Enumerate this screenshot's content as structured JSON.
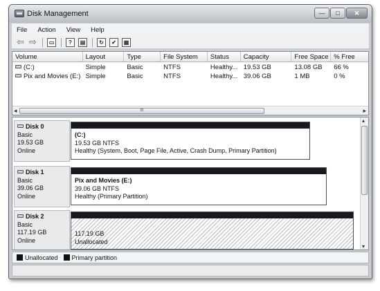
{
  "window": {
    "title": "Disk Management",
    "controls": {
      "minimize": "—",
      "maximize": "□",
      "close": "✕"
    }
  },
  "menu": [
    {
      "label": "File"
    },
    {
      "label": "Action"
    },
    {
      "label": "View"
    },
    {
      "label": "Help"
    }
  ],
  "toolbar": {
    "items": [
      "back-icon",
      "forward-icon",
      "view-toggle-icon",
      "help-icon",
      "detail-pane-icon",
      "refresh-icon",
      "properties-icon",
      "disk-settings-icon"
    ]
  },
  "volume_list": {
    "columns": [
      "Volume",
      "Layout",
      "Type",
      "File System",
      "Status",
      "Capacity",
      "Free Space",
      "% Free"
    ],
    "rows": [
      {
        "volume": "(C:)",
        "layout": "Simple",
        "type": "Basic",
        "fs": "NTFS",
        "status": "Healthy...",
        "capacity": "19.53 GB",
        "free": "13.08 GB",
        "pct": "66 %"
      },
      {
        "volume": "Pix and Movies (E:)",
        "layout": "Simple",
        "type": "Basic",
        "fs": "NTFS",
        "status": "Healthy...",
        "capacity": "39.06 GB",
        "free": "1 MB",
        "pct": "0 %"
      }
    ],
    "scroll_grip": "III"
  },
  "disks": [
    {
      "name": "Disk 0",
      "type": "Basic",
      "size": "19.53 GB",
      "state": "Online",
      "partition": {
        "title": "(C:)",
        "size_fs": "19.53 GB NTFS",
        "status": "Healthy (System, Boot, Page File, Active, Crash Dump, Primary Partition)"
      }
    },
    {
      "name": "Disk 1",
      "type": "Basic",
      "size": "39.06 GB",
      "state": "Online",
      "partition": {
        "title": "Pix and Movies  (E:)",
        "size_fs": "39.06 GB NTFS",
        "status": "Healthy (Primary Partition)"
      }
    },
    {
      "name": "Disk 2",
      "type": "Basic",
      "size": "117.19 GB",
      "state": "Online",
      "partition": {
        "title": "",
        "size_fs": "117.19 GB",
        "status": "Unallocated"
      }
    }
  ],
  "legend": [
    {
      "label": "Unallocated",
      "color": "#111111"
    },
    {
      "label": "Primary partition",
      "color": "#111111"
    }
  ]
}
